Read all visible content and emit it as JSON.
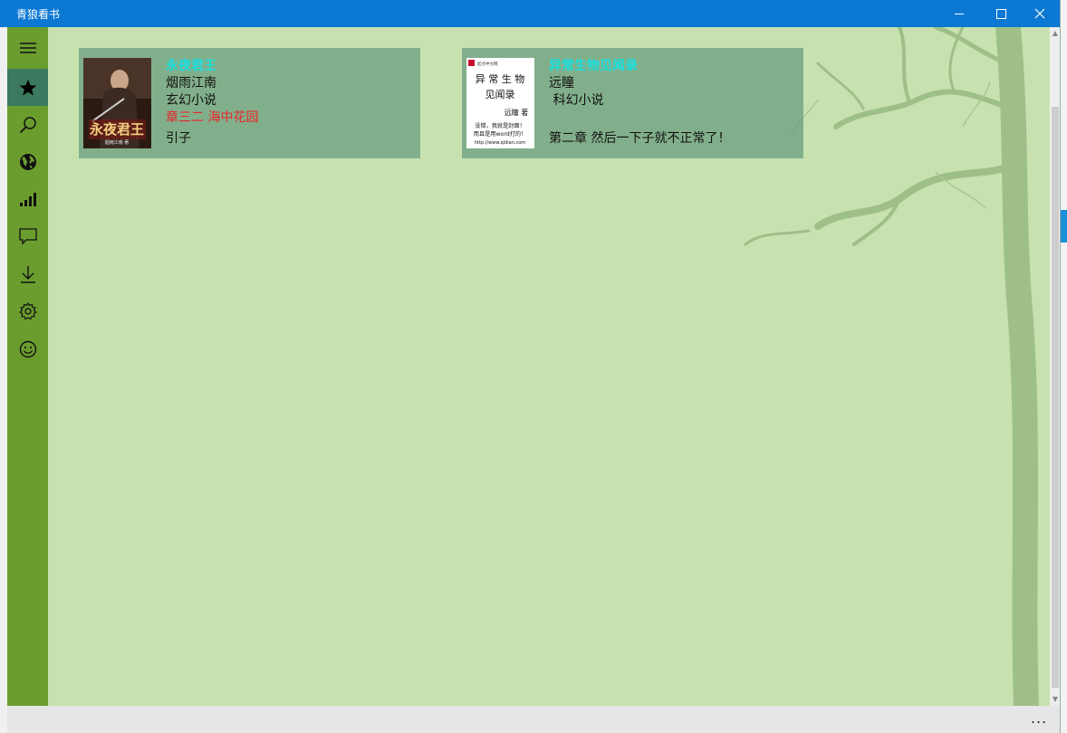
{
  "window": {
    "title": "青狼看书"
  },
  "colors": {
    "titlebar": "#0b78d4",
    "sidebar": "#6a9d2e",
    "sidebar_active": "#3b7a5e",
    "background": "#c7e2af",
    "book_title": "#19e0e0",
    "chapter": "#e8262a"
  },
  "sidebar": {
    "items": [
      {
        "icon": "hamburger-menu-icon"
      },
      {
        "icon": "star-icon",
        "active": true
      },
      {
        "icon": "search-icon"
      },
      {
        "icon": "globe-icon"
      },
      {
        "icon": "signal-bars-icon"
      },
      {
        "icon": "chat-bubble-icon"
      },
      {
        "icon": "download-icon"
      },
      {
        "icon": "gear-icon"
      },
      {
        "icon": "smiley-icon"
      }
    ]
  },
  "books": [
    {
      "title": "永夜君王",
      "author": "烟雨江南",
      "category": "玄幻小说",
      "chapter": "章三二 海中花园",
      "last_read": "引子",
      "cover_title": "永夜君王",
      "cover_author": "烟雨江南 著"
    },
    {
      "title": "异常生物见闻录",
      "author": "远瞳",
      "category": " 科幻小说",
      "chapter": "",
      "last_read": "第二章 然后一下子就不正常了！",
      "cover_line1": "异 常 生 物",
      "cover_line2": "见闻录",
      "cover_author": "远瞳 著",
      "cover_note1": "没错，我就是封面！",
      "cover_note2": "而且是用word打的！",
      "cover_url": "http://www.qidian.com",
      "cover_site": "起点中文网"
    }
  ],
  "appbar": {
    "more_label": "..."
  }
}
